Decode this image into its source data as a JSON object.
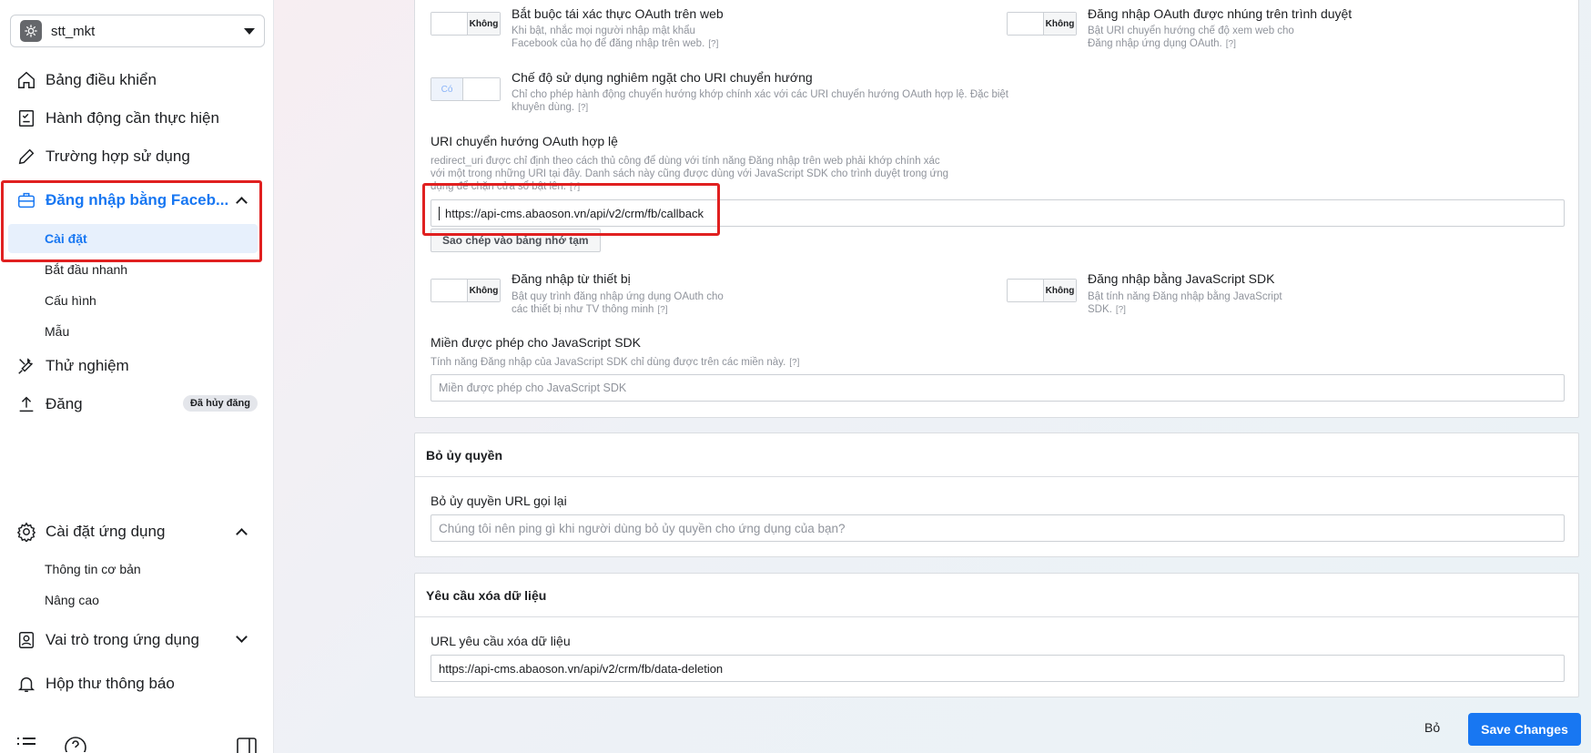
{
  "sidebar": {
    "app_name": "stt_mkt",
    "dashboard": "Bảng điều khiển",
    "actions": "Hành động cần thực hiện",
    "use_cases": "Trường hợp sử dụng",
    "fb_login": "Đăng nhập bằng Faceb...",
    "fb_login_sub": [
      "Cài đặt",
      "Bắt đầu nhanh",
      "Cấu hình",
      "Mẫu"
    ],
    "testing": "Thử nghiệm",
    "publish": "Đăng",
    "publish_badge": "Đã hủy đăng",
    "app_settings": "Cài đặt ứng dụng",
    "app_settings_sub": [
      "Thông tin cơ bản",
      "Nâng cao"
    ],
    "app_roles": "Vai trò trong ứng dụng",
    "inbox": "Hộp thư thông báo"
  },
  "settings": {
    "reauth": {
      "toggle": "Không",
      "title": "Bắt buộc tái xác thực OAuth trên web",
      "desc_line1": "Khi bật, nhắc mọi người nhập mật khẩu",
      "desc_line2": "Facebook của họ để đăng nhập trên web.",
      "help": "[?]"
    },
    "embedded": {
      "toggle": "Không",
      "title": "Đăng nhập OAuth được nhúng trên trình duyệt",
      "desc_line1": "Bật URI chuyển hướng chế độ xem web cho",
      "desc_line2": "Đăng nhập ứng dụng OAuth.",
      "help": "[?]"
    },
    "strict": {
      "toggle": "Có",
      "title": "Chế độ sử dụng nghiêm ngặt cho URI chuyển hướng",
      "desc_line1": "Chỉ cho phép hành động chuyển hướng khớp chính xác với các URI chuyển hướng OAuth hợp lệ. Đặc biệt",
      "desc_line2": "khuyên dùng.",
      "help": "[?]"
    },
    "redirect": {
      "label": "URI chuyển hướng OAuth hợp lệ",
      "desc_line1": "redirect_uri được chỉ định theo cách thủ công để dùng với tính năng Đăng nhập trên web phải khớp chính xác",
      "desc_line2": "với một trong những URI tại đây. Danh sách này cũng được dùng với JavaScript SDK cho trình duyệt trong ứng",
      "desc_line3": "dụng để chặn cửa sổ bật lên.",
      "help": "[?]",
      "value": "https://api-cms.abaoson.vn/api/v2/crm/fb/callback",
      "copy_label": "Sao chép vào bảng nhớ tạm"
    },
    "device": {
      "toggle": "Không",
      "title": "Đăng nhập từ thiết bị",
      "desc_line1": "Bật quy trình đăng nhập ứng dụng OAuth cho",
      "desc_line2": "các thiết bị như TV thông minh",
      "help": "[?]"
    },
    "jssdk": {
      "toggle": "Không",
      "title": "Đăng nhập bằng JavaScript SDK",
      "desc_line1": "Bật tính năng Đăng nhập bằng JavaScript",
      "desc_line2": "SDK.",
      "help": "[?]"
    },
    "domains": {
      "label": "Miền được phép cho JavaScript SDK",
      "desc": "Tính năng Đăng nhập của JavaScript SDK chỉ dùng được trên các miền này.",
      "help": "[?]",
      "placeholder": "Miền được phép cho JavaScript SDK"
    }
  },
  "deauth": {
    "header": "Bỏ ủy quyền",
    "label": "Bỏ ủy quyền URL gọi lại",
    "placeholder": "Chúng tôi nên ping gì khi người dùng bỏ ủy quyền cho ứng dụng của bạn?"
  },
  "deletion": {
    "header": "Yêu cầu xóa dữ liệu",
    "label": "URL yêu cầu xóa dữ liệu",
    "value": "https://api-cms.abaoson.vn/api/v2/crm/fb/data-deletion"
  },
  "footer": {
    "discard": "Bỏ",
    "save": "Save Changes"
  },
  "colors": {
    "accent": "#1877f2",
    "highlight": "#e02020"
  }
}
